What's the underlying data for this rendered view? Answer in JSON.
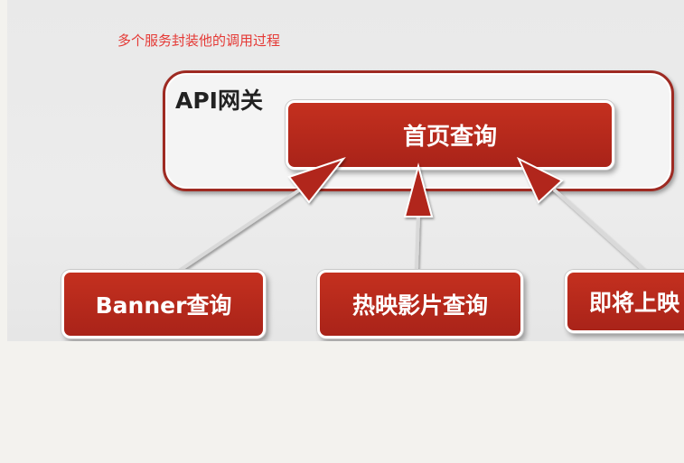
{
  "diagram": {
    "subtitle": "多个服务封装他的调用过程",
    "gateway_label": "API网关",
    "home_query": "首页查询",
    "services": {
      "banner": "Banner查询",
      "hot_movies": "热映影片查询",
      "upcoming": "即将上映"
    },
    "colors": {
      "box_fill": "#b1261c",
      "gateway_border": "#9e2a22",
      "subtitle": "#e53935"
    }
  }
}
